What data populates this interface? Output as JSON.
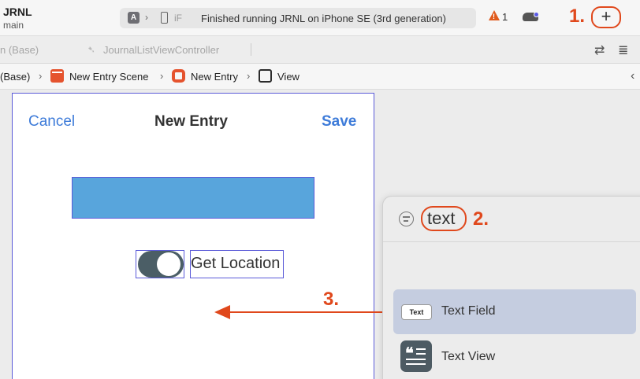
{
  "toolbar": {
    "project_name": "JRNL",
    "branch": "main",
    "device_label": "iF",
    "status": "Finished running JRNL on iPhone SE (3rd generation)",
    "warning_count": "1",
    "add_label": "+"
  },
  "steps": {
    "one": "1.",
    "two": "2.",
    "three": "3."
  },
  "tabs": [
    {
      "label": "n (Base)"
    },
    {
      "label": "JournalListViewController"
    }
  ],
  "breadcrumb": [
    {
      "label": "(Base)"
    },
    {
      "label": "New Entry Scene"
    },
    {
      "label": "New Entry"
    },
    {
      "label": "View"
    }
  ],
  "scene": {
    "cancel": "Cancel",
    "title": "New Entry",
    "save": "Save",
    "location_label": "Get Location"
  },
  "library": {
    "search_value": "text",
    "items": [
      {
        "icon": "text-field-icon",
        "icon_text": "Text",
        "label": "Text Field",
        "selected": true
      },
      {
        "icon": "text-view-icon",
        "label": "Text View",
        "selected": false
      }
    ]
  },
  "colors": {
    "accent": "#e0481c",
    "nav_blue": "#3d7bd9",
    "image_view": "#58a5dc",
    "selection": "#5a5ad8"
  }
}
